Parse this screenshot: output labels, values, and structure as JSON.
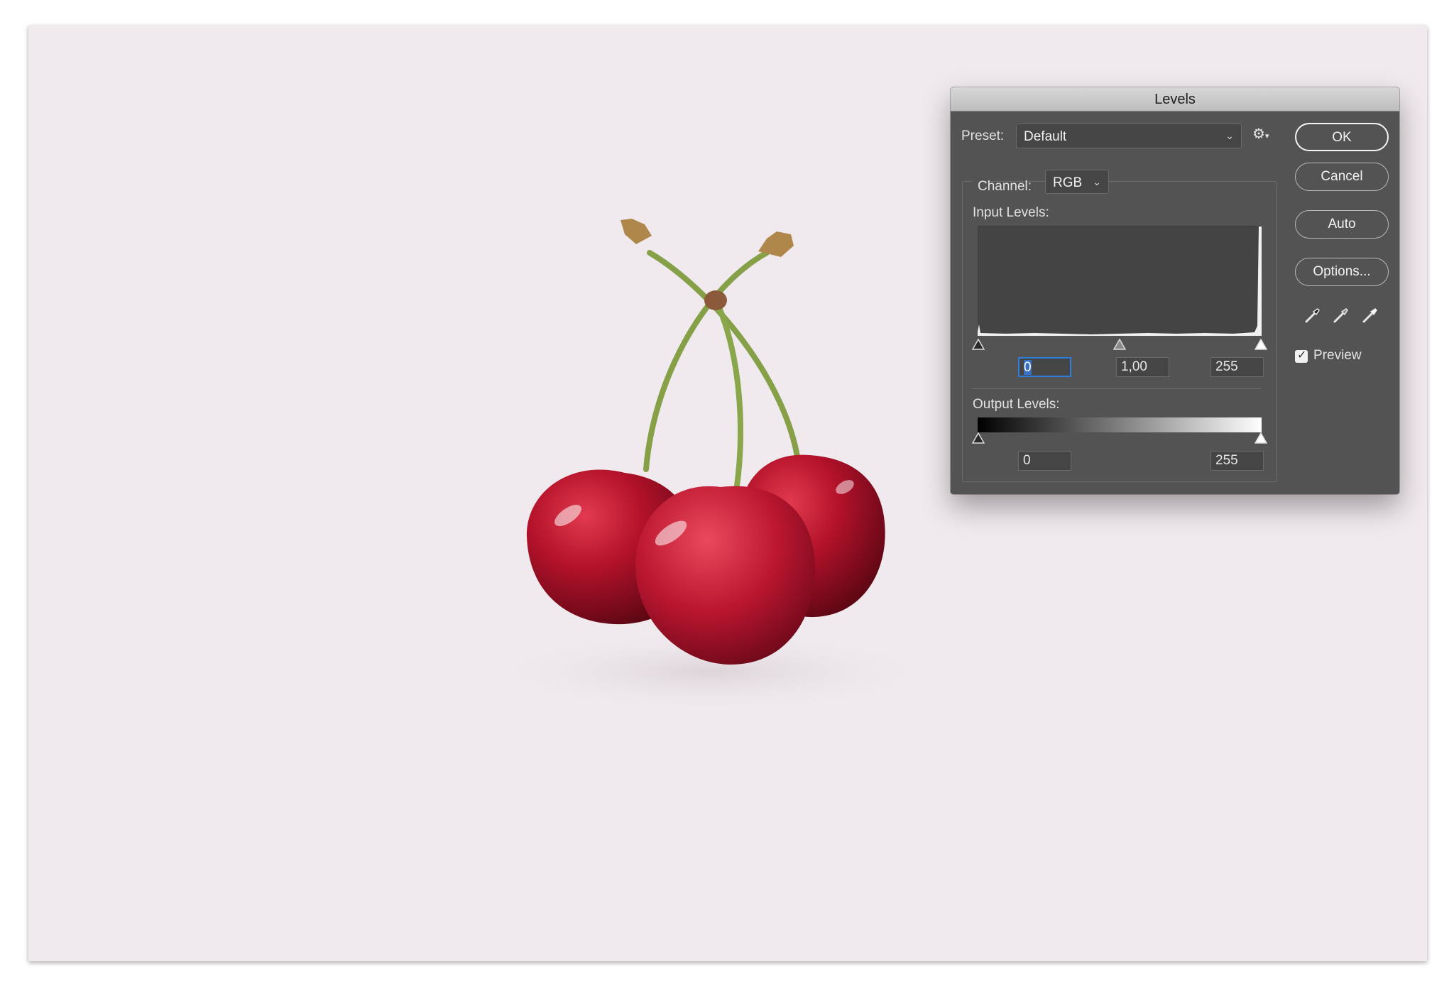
{
  "canvas": {
    "background_color": "#f0eaee"
  },
  "dialog": {
    "title": "Levels",
    "preset": {
      "label": "Preset:",
      "value": "Default"
    },
    "preset_options_icon": "gear-icon",
    "channel": {
      "label": "Channel:",
      "value": "RGB"
    },
    "input_levels": {
      "label": "Input Levels:",
      "black": "0",
      "gamma": "1,00",
      "white": "255"
    },
    "output_levels": {
      "label": "Output Levels:",
      "black": "0",
      "white": "255"
    },
    "buttons": {
      "ok": "OK",
      "cancel": "Cancel",
      "auto": "Auto",
      "options": "Options..."
    },
    "eyedroppers": [
      "black-point-eyedropper-icon",
      "gray-point-eyedropper-icon",
      "white-point-eyedropper-icon"
    ],
    "preview": {
      "label": "Preview",
      "checked": true
    }
  },
  "colors": {
    "dialog_bg": "#535353",
    "focus": "#2e7ddb",
    "cherry": "#b3122a"
  }
}
